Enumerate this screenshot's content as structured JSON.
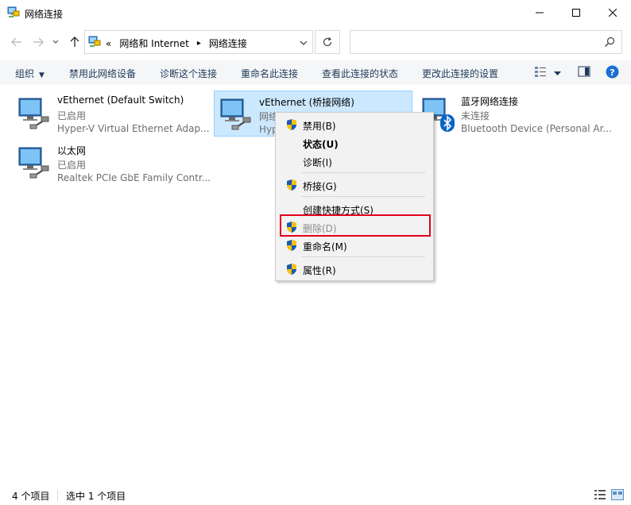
{
  "window": {
    "title": "网络连接"
  },
  "address": {
    "prefix": "«",
    "crumbs": [
      "网络和 Internet",
      "网络连接"
    ],
    "search_placeholder": ""
  },
  "toolbar": {
    "organize": "组织",
    "disable": "禁用此网络设备",
    "diagnose": "诊断这个连接",
    "rename": "重命名此连接",
    "view_status": "查看此连接的状态",
    "change_settings": "更改此连接的设置"
  },
  "connections": [
    {
      "name": "vEthernet (Default Switch)",
      "status": "已启用",
      "device": "Hyper-V Virtual Ethernet Adap...",
      "badge": ""
    },
    {
      "name": "vEthernet (桥接网络)",
      "status": "网络",
      "device": "Hyp",
      "badge": ""
    },
    {
      "name": "蓝牙网络连接",
      "status": "未连接",
      "device": "Bluetooth Device (Personal Ar...",
      "badge": "bluetooth-icon"
    },
    {
      "name": "以太网",
      "status": "已启用",
      "device": "Realtek PCIe GbE Family Contr...",
      "badge": ""
    }
  ],
  "context_menu": {
    "items": [
      {
        "label": "禁用(B)",
        "shield": true
      },
      {
        "label": "状态(U)",
        "bold": true
      },
      {
        "label": "诊断(I)"
      },
      {
        "label": "桥接(G)",
        "shield": true
      },
      {
        "label": "创建快捷方式(S)"
      },
      {
        "label": "删除(D)",
        "shield": true,
        "disabled": true
      },
      {
        "label": "重命名(M)",
        "shield": true
      },
      {
        "label": "属性(R)",
        "shield": true
      }
    ]
  },
  "statusbar": {
    "count": "4 个项目",
    "selected": "选中 1 个项目"
  },
  "colors": {
    "accent": "#0078d7",
    "selection_bg": "#cce8ff",
    "highlight": "#e3001b"
  }
}
